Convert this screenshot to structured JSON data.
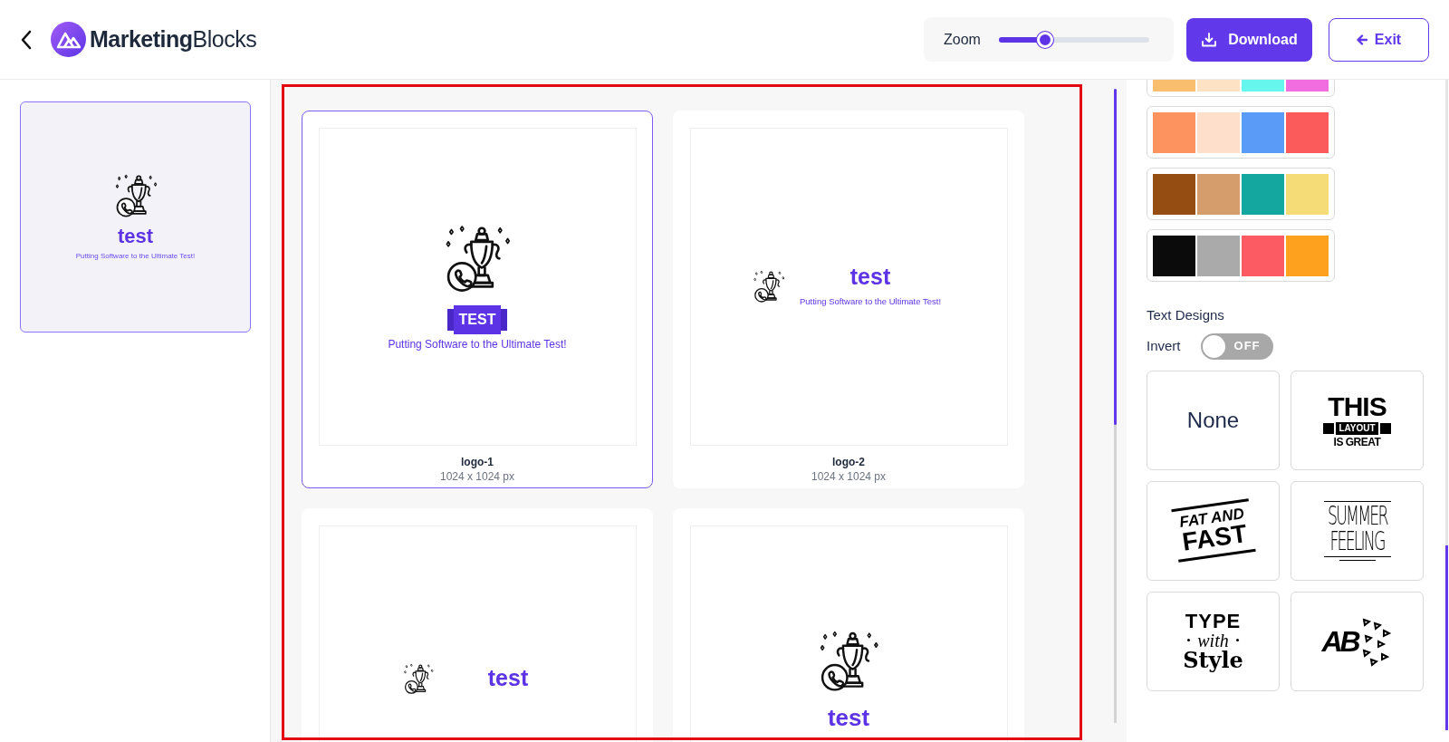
{
  "header": {
    "brand": {
      "bold": "Marketing",
      "light": "Blocks"
    },
    "zoom": {
      "label": "Zoom",
      "level": 0.31
    },
    "buttons": [
      {
        "label": "Download",
        "kind": "primary"
      },
      {
        "label": "Exit",
        "kind": "outline"
      }
    ]
  },
  "pages": [
    {
      "title": "test",
      "tagline": "Putting Software to the Ultimate Test!",
      "selected": true
    }
  ],
  "logos": [
    {
      "kind": "badge",
      "title": "TEST",
      "tagline": "Putting Software to the Ultimate Test!",
      "name": "logo-1",
      "size": "1024 x 1024 px",
      "selected": true
    },
    {
      "kind": "side",
      "title": "test",
      "tagline": "Putting Software to the Ultimate Test!",
      "name": "logo-2",
      "size": "1024 x 1024 px",
      "selected": false
    },
    {
      "kind": "wide",
      "title": "test",
      "selected": false
    },
    {
      "kind": "stacked",
      "title": "test",
      "selected": false
    }
  ],
  "palettes": [
    {
      "swatches": [
        {
          "color": "#f9bf6e"
        },
        {
          "color": "#fde3c4"
        },
        {
          "color": "#67f6ee"
        },
        {
          "color": "#f26de0"
        }
      ]
    },
    {
      "swatches": [
        {
          "color": "#fd9460"
        },
        {
          "color": "#fedfcb"
        },
        {
          "color": "#5b9bf8"
        },
        {
          "color": "#fc5b5b"
        }
      ]
    },
    {
      "swatches": [
        {
          "color": "#964d12"
        },
        {
          "color": "#d49d6b"
        },
        {
          "color": "#14a79f"
        },
        {
          "color": "#f6dc76"
        }
      ]
    },
    {
      "swatches": [
        {
          "color": "#0b0b0b"
        },
        {
          "color": "#aaaaaa"
        },
        {
          "color": "#fd5b64"
        },
        {
          "color": "#fea11f"
        }
      ]
    }
  ],
  "text_designs": {
    "title": "Text Designs",
    "invert": {
      "label": "Invert",
      "on": false,
      "state_text": "OFF"
    },
    "options": [
      {
        "kind": "none",
        "lines": [
          "None"
        ]
      },
      {
        "kind": "banner",
        "lines": [
          "THIS",
          "LAYOUT",
          "IS GREAT"
        ]
      },
      {
        "kind": "slanted",
        "lines": [
          "FAT AND",
          "FAST"
        ]
      },
      {
        "kind": "thin",
        "lines": [
          "SUMMER",
          "FEELING"
        ]
      },
      {
        "kind": "script",
        "lines": [
          "TYPE",
          "with",
          "Style"
        ]
      },
      {
        "kind": "scatter",
        "lines": [
          "AB"
        ]
      }
    ]
  }
}
